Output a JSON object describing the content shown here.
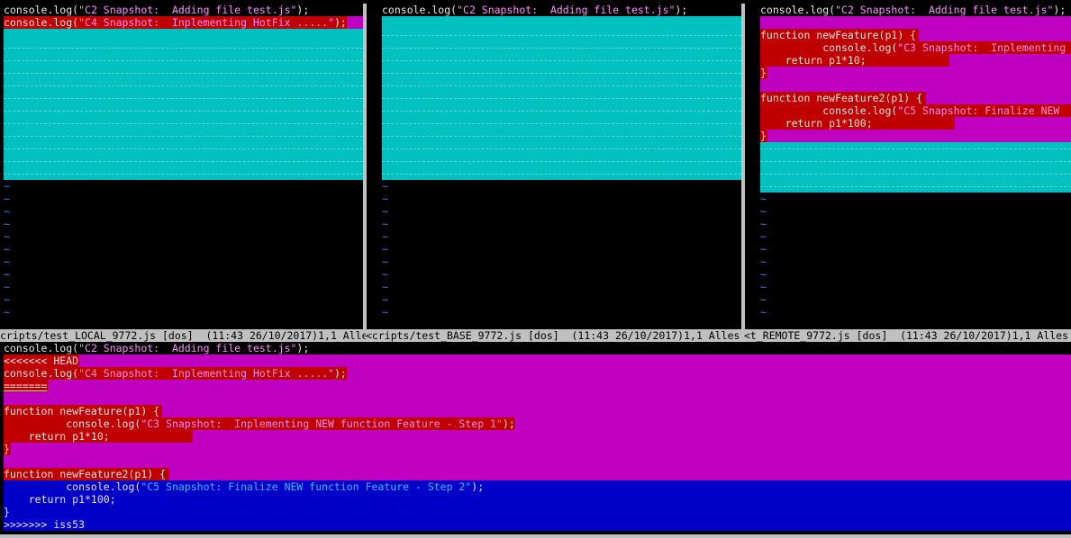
{
  "panes": {
    "local": {
      "line1": {
        "pre": "console.log(",
        "str": "\"C2 Snapshot:  Adding file test.js\"",
        "post": ");"
      },
      "line2": {
        "pre": "console.log(",
        "str": "\"C4 Snapshot:  Inplementing HotFix .....\"",
        "post": ");"
      },
      "status": "cripts/test_LOCAL_9772.js [dos]  (11:43 26/10/2017)1,1 Alles"
    },
    "base": {
      "line1": {
        "pre": "console.log(",
        "str": "\"C2 Snapshot:  Adding file test.js\"",
        "post": ");"
      },
      "status": "<cripts/test_BASE_9772.js [dos]  (11:43 26/10/2017)1,1 Alles"
    },
    "remote": {
      "line1": {
        "pre": "console.log(",
        "str": "\"C2 Snapshot:  Adding file test.js\"",
        "post": ");"
      },
      "f1": "function newFeature(p1) {",
      "f1_log_pre": "          console.log(",
      "f1_log_str": "\"C3 Snapshot:  Inplementing",
      "f1_ret": "    return p1*10;",
      "f1_close": "}",
      "f2": "function newFeature2(p1) {",
      "f2_log_pre": "          console.log(",
      "f2_log_str": "\"C5 Snapshot: Finalize NEW",
      "f2_ret": "    return p1*100;",
      "f2_close": "}",
      "status": "<t_REMOTE_9772.js [dos]  (11:43 26/10/2017)1,1 Alles"
    }
  },
  "merged": {
    "line1": {
      "pre": "console.log(",
      "str": "\"C2 Snapshot:  Adding file test.js\"",
      "post": ");"
    },
    "head": "<<<<<<< HEAD",
    "hotfix": {
      "pre": "console.log(",
      "str": "\"C4 Snapshot:  Inplementing HotFix .....\"",
      "post": ");"
    },
    "sep": "=======",
    "f1": "function newFeature(p1) {",
    "f1_log": {
      "pre": "          console.log(",
      "str": "\"C3 Snapshot:  Inplementing NEW function Feature - Step 1\"",
      "post": ");"
    },
    "f1_ret": "    return p1*10;",
    "f1_close": "}",
    "f2": "function newFeature2(p1) {",
    "f2_log": {
      "pre": "          console.log(",
      "str": "\"C5 Snapshot: Finalize NEW function Feature - Step 2\"",
      "post": ");"
    },
    "f2_ret": "    return p1*100;",
    "f2_close": "}",
    "tail": ">>>>>>> iss53"
  },
  "tilde": "~",
  "colors": {
    "diff_change": "#c000c0",
    "diff_text": "#c00000",
    "filler": "#00c0c0",
    "diff_add": "#0000c8"
  }
}
